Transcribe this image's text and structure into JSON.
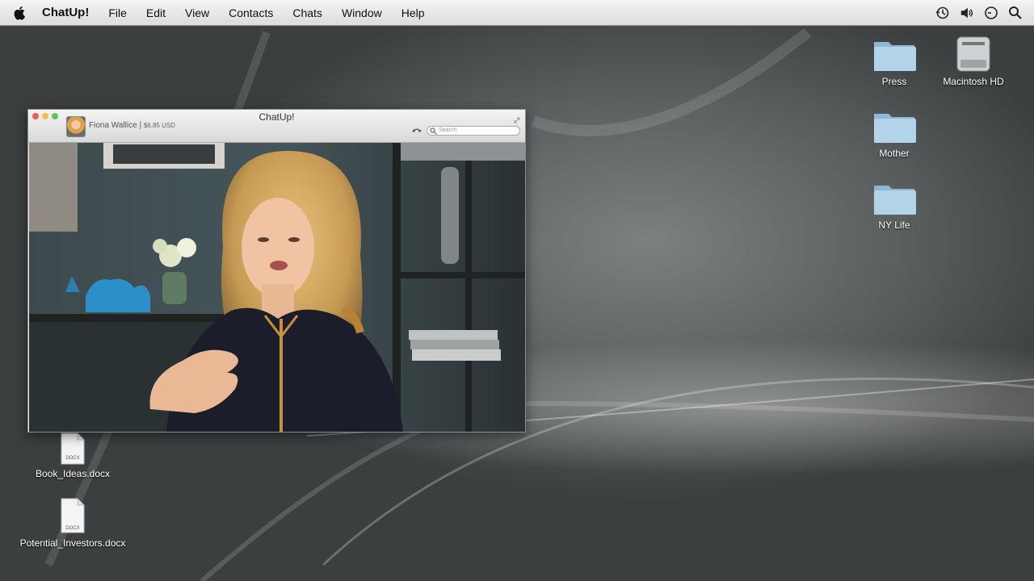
{
  "menubar": {
    "app_name": "ChatUp!",
    "items": [
      "File",
      "Edit",
      "View",
      "Contacts",
      "Chats",
      "Window",
      "Help"
    ],
    "right_icons": [
      "time-machine-icon",
      "volume-icon",
      "clock-icon",
      "spotlight-search-icon"
    ]
  },
  "window": {
    "title": "ChatUp!",
    "contact_name": "Fiona Wallice",
    "separator": "|",
    "balance": "$6.85 USD",
    "search_placeholder": "Search"
  },
  "desktop": {
    "right_icons": [
      {
        "label": "Press",
        "icon": "folder-icon"
      },
      {
        "label": "Macintosh HD",
        "icon": "hard-drive-icon"
      },
      {
        "label": "Mother",
        "icon": "folder-icon"
      },
      {
        "label": "NY Life",
        "icon": "folder-icon"
      }
    ],
    "files": [
      {
        "label": "Book_Ideas.docx",
        "badge": "DOCX"
      },
      {
        "label": "Potential_Investors.docx",
        "badge": "DOCX"
      }
    ]
  },
  "colors": {
    "close": "#f25b56",
    "minimize": "#f4be4f",
    "zoom": "#5fc454",
    "folder": "#a8cbe0"
  }
}
